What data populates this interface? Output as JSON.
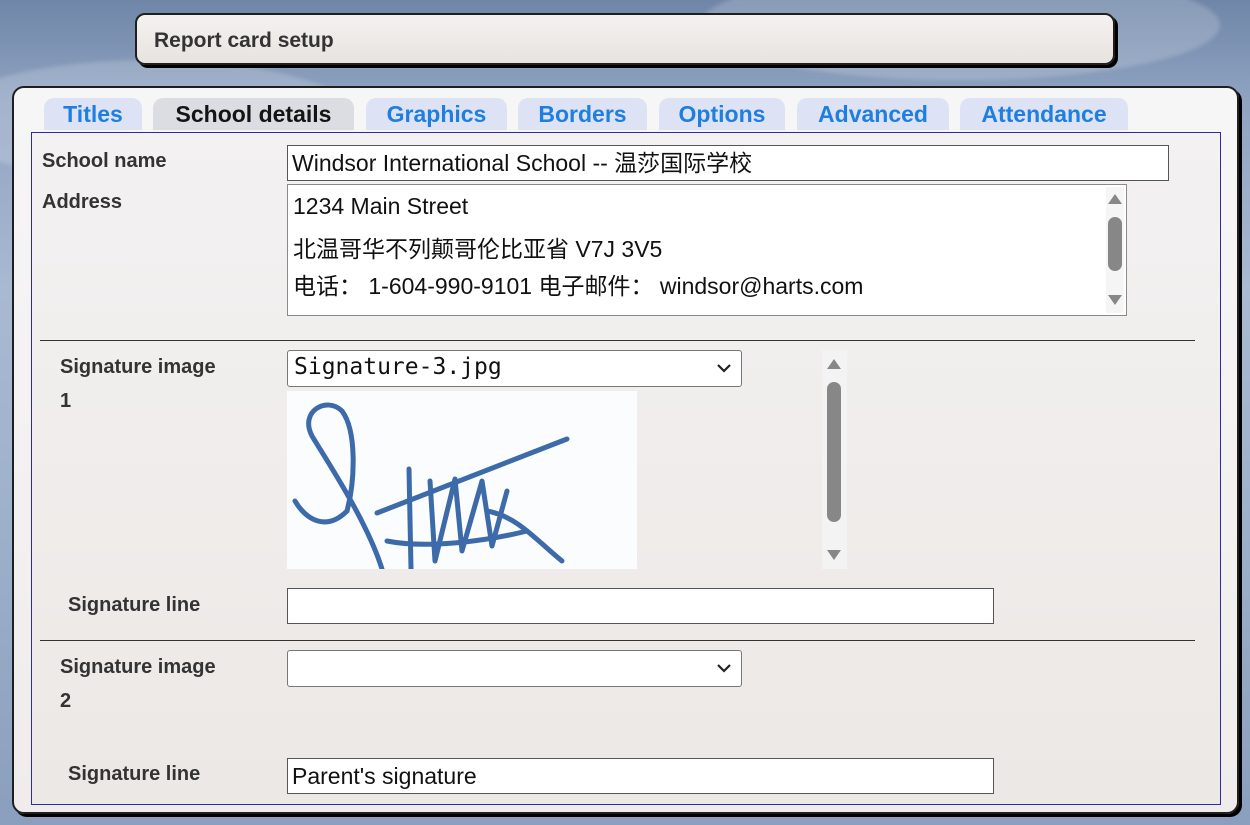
{
  "window": {
    "title": "Report card setup"
  },
  "tabs": [
    {
      "label": "Titles",
      "active": false
    },
    {
      "label": "School details",
      "active": true
    },
    {
      "label": "Graphics",
      "active": false
    },
    {
      "label": "Borders",
      "active": false
    },
    {
      "label": "Options",
      "active": false
    },
    {
      "label": "Advanced",
      "active": false
    },
    {
      "label": "Attendance",
      "active": false
    }
  ],
  "school": {
    "name_label": "School name",
    "name_value": "Windsor International School -- 温莎国际学校",
    "address_label": "Address",
    "address_lines": [
      "1234 Main Street",
      "北温哥华不列颠哥伦比亚省 V7J 3V5",
      "电话： 1-604-990-9101 电子邮件： windsor@harts.com"
    ]
  },
  "signature1": {
    "label_line1": "Signature image",
    "label_line2": "1",
    "selected_file": "Signature-3.jpg",
    "line_label": "Signature line",
    "line_value": ""
  },
  "signature2": {
    "label_line1": "Signature image",
    "label_line2": "2",
    "selected_file": "",
    "line_label": "Signature line",
    "line_value": "Parent's signature"
  },
  "colors": {
    "tab_text": "#1e7fe0",
    "tab_bg": "#dde3f5",
    "active_tab_bg": "#dcdde2",
    "inner_border": "#2d2aa3",
    "signature_ink": "#3d6aa8"
  }
}
